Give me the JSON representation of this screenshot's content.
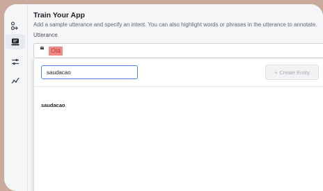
{
  "sidebar": {
    "items": [
      {
        "icon": "flow-icon",
        "active": false
      },
      {
        "icon": "chat-icon",
        "active": true
      },
      {
        "icon": "sliders-icon",
        "active": false
      },
      {
        "icon": "analytics-icon",
        "active": false
      }
    ]
  },
  "main": {
    "title": "Train Your App",
    "subtitle": "Add a sample utterance and specify an intent. You can also highlight words or phrases in the utterance to annotate.",
    "utterance_label": "Utterance",
    "utterance_text": "Olá",
    "highlight_color": "#f08a8a"
  },
  "entity_dropdown": {
    "search_value": "saudacao",
    "create_button_label": "Create Entity",
    "results": [
      "saudacao"
    ],
    "accent_color": "#4d7fd6"
  }
}
